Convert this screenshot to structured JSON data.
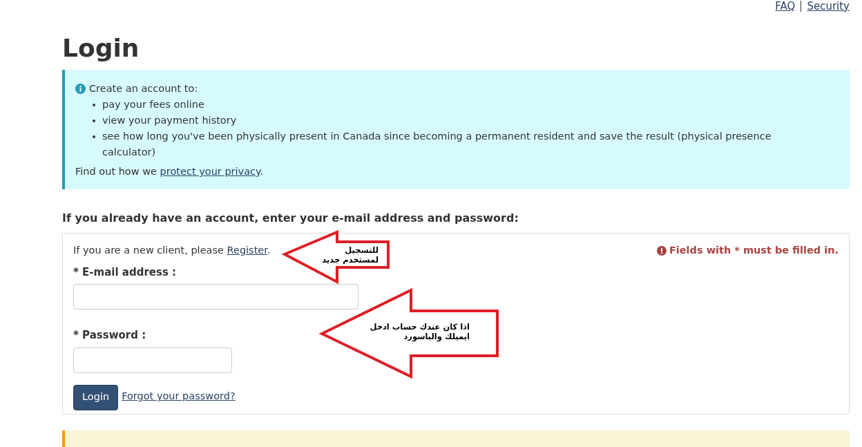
{
  "top_links": [
    "FAQ",
    "Security"
  ],
  "title": "Login",
  "info": {
    "intro": "Create an account to:",
    "items": [
      "pay your fees online",
      "view your payment history",
      "see how long you've been physically present in Canada since becoming a permanent resident and save the result (physical presence calculator)"
    ],
    "privacy_before": "Find out how we ",
    "privacy_link": "protect your privacy",
    "privacy_after": "."
  },
  "form_heading": "If you already have an account, enter your e-mail address and password:",
  "form": {
    "new_client_before": "If you are a new client, please ",
    "register_link": "Register",
    "new_client_after": ".",
    "required_note": "Fields with * must be filled in.",
    "fields": [
      {
        "label": "* E-mail address :",
        "kind": "email"
      },
      {
        "label": "* Password :",
        "kind": "password"
      }
    ],
    "login_button": "Login",
    "forgot_link": "Forgot your password?"
  },
  "annotations": [
    {
      "text": "للتسجيل\nلمستخدم جديد"
    },
    {
      "text": "اذا كان عندك حساب ادخل\nايميلك والباسورد"
    }
  ]
}
